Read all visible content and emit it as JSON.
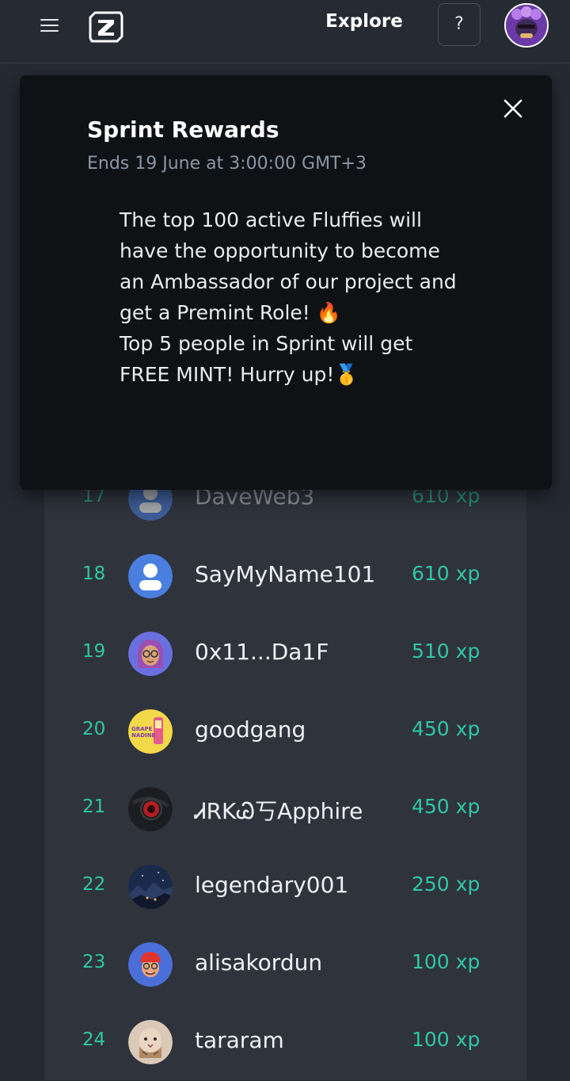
{
  "header": {
    "nav_label": "Explore",
    "help_label": "?",
    "logo_letter": "Z",
    "icons": {
      "menu": "hamburger-icon",
      "logo": "z-logo-icon",
      "help": "question-mark",
      "avatar": "user-avatar"
    }
  },
  "modal": {
    "title": "Sprint Rewards",
    "subtitle": "Ends 19 June at 3:00:00 GMT+3",
    "body_line1": "The top 100 active Fluffies will have the opportunity to become an Ambassador of our project and get a Premint Role! 🔥",
    "body_line2": "Top 5 people in Sprint will get FREE MINT! Hurry up!🥇",
    "close_icon": "close-icon"
  },
  "leaderboard": {
    "rows": [
      {
        "rank": "17",
        "name": "DaveWeb3",
        "xp": "610 xp",
        "avatar": "default-user"
      },
      {
        "rank": "18",
        "name": "SayMyName101",
        "xp": "610 xp",
        "avatar": "default-user"
      },
      {
        "rank": "19",
        "name": "0x11...Da1F",
        "xp": "510 xp",
        "avatar": "memoji-glasses"
      },
      {
        "rank": "20",
        "name": "goodgang",
        "xp": "450 xp",
        "avatar": "grape-nadine",
        "avatar_text": "GRAPE NADINE"
      },
      {
        "rank": "21",
        "name": "ᏗRKᏊ丂Apphire",
        "xp": "450 xp",
        "avatar": "red-eye"
      },
      {
        "rank": "22",
        "name": "legendary001",
        "xp": "250 xp",
        "avatar": "night-landscape"
      },
      {
        "rank": "23",
        "name": "alisakordun",
        "xp": "100 xp",
        "avatar": "memoji-red-cap"
      },
      {
        "rank": "24",
        "name": "tararam",
        "xp": "100 xp",
        "avatar": "cat-face"
      }
    ]
  },
  "colors": {
    "background": "#262a33",
    "panel": "#2f333c",
    "modal": "#0f1215",
    "accent": "#2fc7a6",
    "subtitle": "#8a97a6"
  }
}
